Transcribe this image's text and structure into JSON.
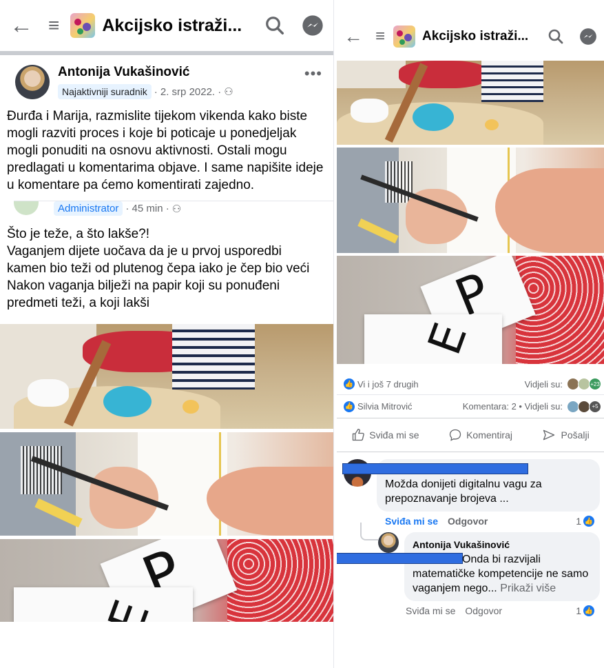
{
  "left": {
    "header": {
      "title": "Akcijsko istraži..."
    },
    "post": {
      "author": "Antonija Vukašinović",
      "badge": "Najaktivniji suradnik",
      "date": "· 2. srp 2022. ·",
      "more": "•••",
      "text": "Đurđa i Marija, razmislite tijekom vikenda kako biste mogli razviti proces i koje bi poticaje u ponedjeljak mogli ponuditi na osnovu aktivnosti. Ostali mogu predlagati u komentarima objave. I same napišite ideje u komentare pa ćemo komentirati zajedno."
    },
    "shared": {
      "badge": "Administrator",
      "time": "· 45 min ·",
      "text_lines": [
        "Što je teže, a što lakše?!",
        "Vaganjem dijete uočava da je u prvoj usporedbi kamen bio teži od plutenog čepa iako je čep bio veći",
        "Nakon vaganja bilježi na papir koji su ponuđeni predmeti teži, a koji lakši"
      ]
    },
    "photo_letters": {
      "p": "P",
      "e": "E"
    }
  },
  "right": {
    "header": {
      "title": "Akcijsko istraži..."
    },
    "photo_letters": {
      "p": "P",
      "e": "E"
    },
    "reactions": {
      "likes_text": "Vi i još 7 drugih",
      "seen_label": "Vidjeli su:",
      "seen_extra": "+23"
    },
    "shared_reactions": {
      "name": "Silvia Mitrović",
      "stats": "Komentara: 2 • Vidjeli su:",
      "seen_extra": "+5"
    },
    "actions": {
      "like": "Sviđa mi se",
      "comment": "Komentiraj",
      "send": "Pošalji"
    },
    "comment1": {
      "text": "Možda donijeti digitalnu vagu za prepoznavanje brojeva ...",
      "like": "Sviđa mi se",
      "reply": "Odgovor",
      "likes": "1"
    },
    "comment2": {
      "author": "Antonija Vukašinović",
      "text_visible": "ć odlično. Onda bi razvijali matematičke kompetencije ne samo vaganjem nego...",
      "more": "Prikaži više",
      "like": "Sviđa mi se",
      "reply": "Odgovor",
      "likes": "1"
    }
  }
}
